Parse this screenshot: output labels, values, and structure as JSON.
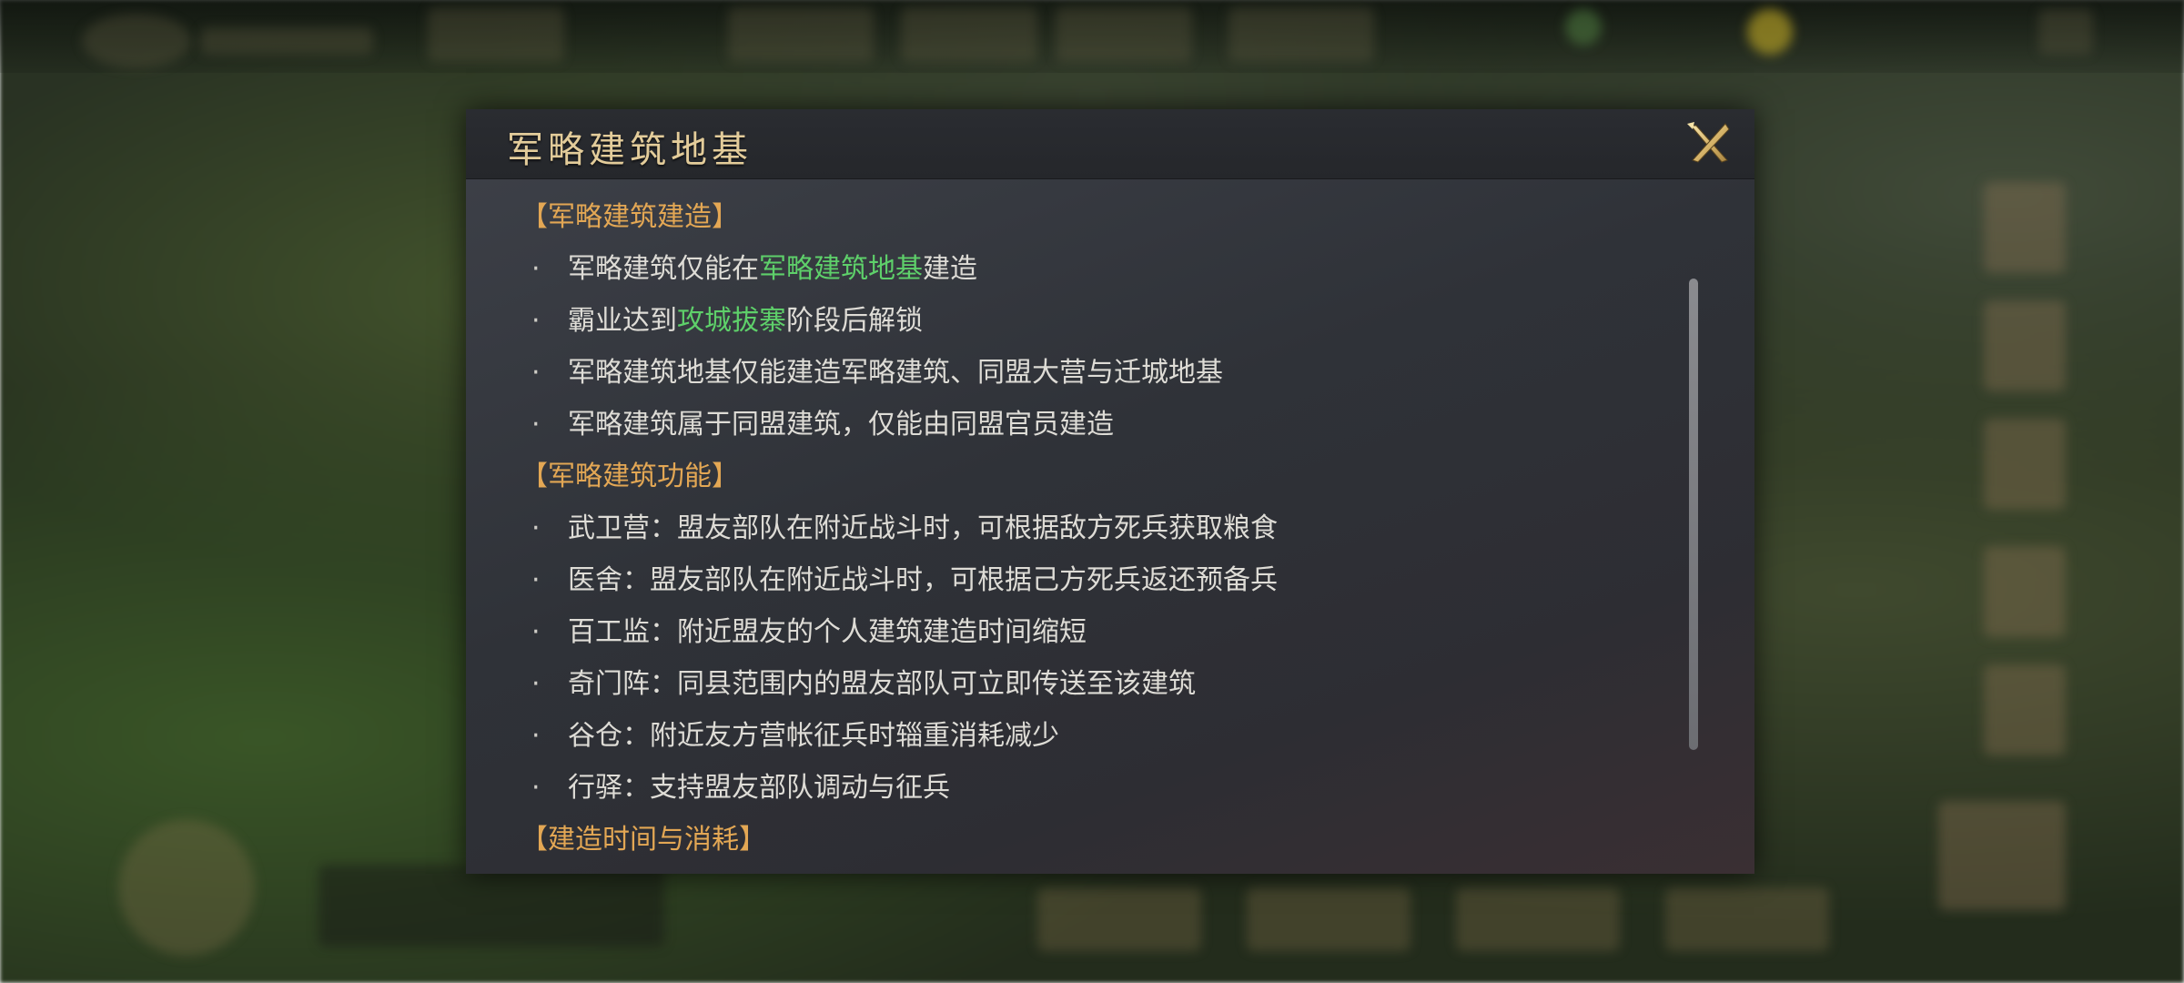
{
  "dialog": {
    "title": "军略建筑地基",
    "close_icon": "close-x-icon",
    "sections": [
      {
        "heading": "【军略建筑建造】",
        "items": [
          {
            "parts": [
              {
                "text": "军略建筑仅能在"
              },
              {
                "text": "军略建筑地基",
                "highlight": true
              },
              {
                "text": "建造"
              }
            ]
          },
          {
            "parts": [
              {
                "text": "霸业达到"
              },
              {
                "text": "攻城拔寨",
                "highlight": true
              },
              {
                "text": "阶段后解锁"
              }
            ]
          },
          {
            "parts": [
              {
                "text": "军略建筑地基仅能建造军略建筑、同盟大营与迁城地基"
              }
            ]
          },
          {
            "parts": [
              {
                "text": "军略建筑属于同盟建筑，仅能由同盟官员建造"
              }
            ]
          }
        ]
      },
      {
        "heading": "【军略建筑功能】",
        "items": [
          {
            "parts": [
              {
                "text": "武卫营：盟友部队在附近战斗时，可根据敌方死兵获取粮食"
              }
            ]
          },
          {
            "parts": [
              {
                "text": "医舍：盟友部队在附近战斗时，可根据己方死兵返还预备兵"
              }
            ]
          },
          {
            "parts": [
              {
                "text": "百工监：附近盟友的个人建筑建造时间缩短"
              }
            ]
          },
          {
            "parts": [
              {
                "text": "奇门阵：同县范围内的盟友部队可立即传送至该建筑"
              }
            ]
          },
          {
            "parts": [
              {
                "text": "谷仓：附近友方营帐征兵时辎重消耗减少"
              }
            ]
          },
          {
            "parts": [
              {
                "text": "行驿：支持盟友部队调动与征兵"
              }
            ]
          }
        ]
      }
    ],
    "partial_heading": "【建造时间与消耗】"
  },
  "colors": {
    "heading": "#e3a754",
    "highlight": "#5ed06a",
    "body_text": "#dedcd6",
    "title": "#e3cc9a"
  }
}
